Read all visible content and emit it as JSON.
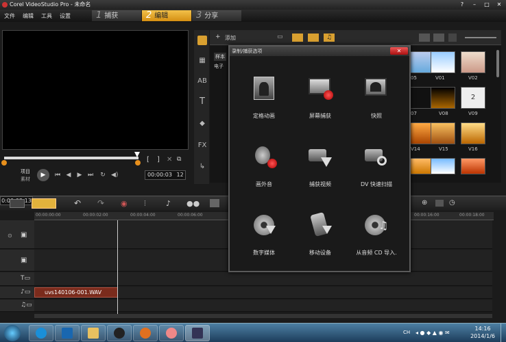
{
  "window": {
    "title": "Corel VideoStudio Pro - 未命名"
  },
  "menu": [
    "文件",
    "编辑",
    "工具",
    "设置"
  ],
  "steps": [
    {
      "num": "1",
      "label": "捕获"
    },
    {
      "num": "2",
      "label": "编辑"
    },
    {
      "num": "3",
      "label": "分享"
    }
  ],
  "preview": {
    "mode_project": "项目",
    "mode_clip": "素材",
    "timecode": "00:00:03",
    "timecode_frame": "12"
  },
  "library": {
    "add_label": "添加",
    "folders": [
      "样本",
      "电子"
    ],
    "thumb_labels": [
      "V01",
      "V02",
      "V08",
      "V09",
      "V14",
      "V15",
      "V16",
      "05",
      "07"
    ]
  },
  "timeline": {
    "ruler": [
      "00:00:00:00",
      "00:00:02:00",
      "00:00:04:00",
      "00:00:06:00",
      "00:00:16:00",
      "00:00:18:00"
    ],
    "clip_name": "uvs140106-001.WAV",
    "timecode": "0:00:03:13"
  },
  "dialog": {
    "title": "录制/捕获选项",
    "options": [
      {
        "label": "定格动画",
        "icon": "stop-motion-icon"
      },
      {
        "label": "屏幕捕获",
        "icon": "screen-capture-icon"
      },
      {
        "label": "快照",
        "icon": "snapshot-icon"
      },
      {
        "label": "画外音",
        "icon": "voiceover-icon"
      },
      {
        "label": "捕获视频",
        "icon": "capture-video-icon"
      },
      {
        "label": "DV 快速扫描",
        "icon": "dv-scan-icon"
      },
      {
        "label": "数字媒体",
        "icon": "digital-media-icon"
      },
      {
        "label": "移动设备",
        "icon": "mobile-device-icon"
      },
      {
        "label": "从音频 CD 导入.",
        "icon": "audio-cd-icon"
      }
    ]
  },
  "taskbar": {
    "lang": "CH",
    "time": "14:16",
    "date": "2014/1/6"
  }
}
